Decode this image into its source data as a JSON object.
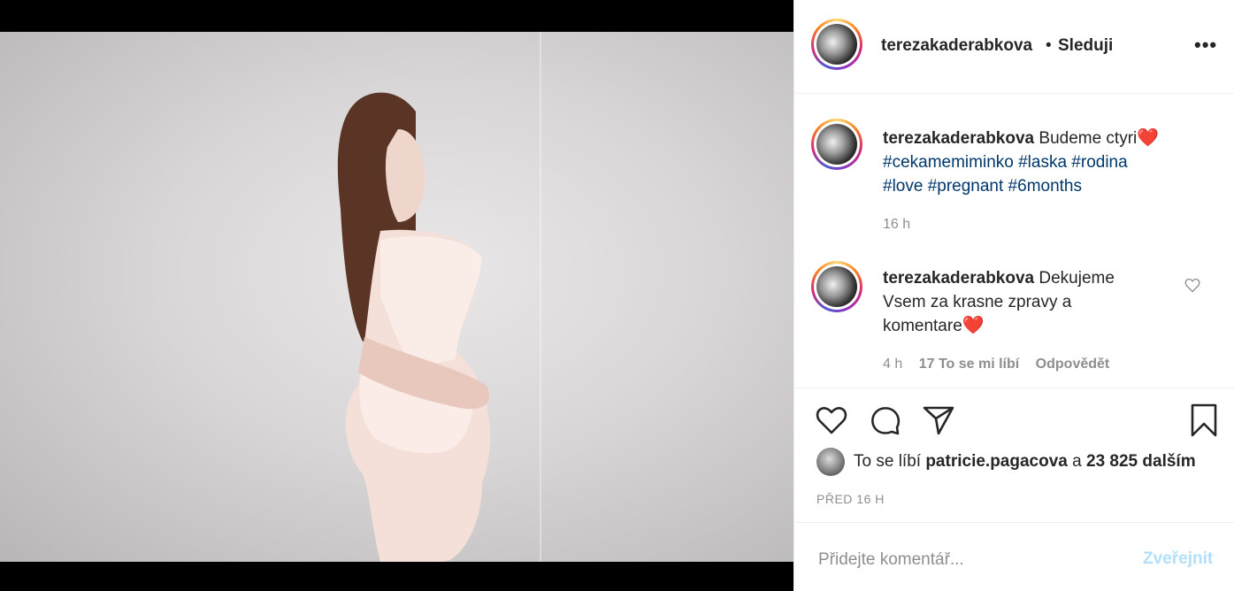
{
  "photo": {
    "alt_name": "post-photo"
  },
  "header": {
    "username": "terezakaderabkova",
    "separator": "•",
    "follow_label": "Sleduji",
    "more_label": "•••"
  },
  "caption": {
    "username": "terezakaderabkova",
    "text": "Budeme ctyri",
    "emoji": "❤️",
    "hashtags_line1": "#cekamemiminko #laska #rodina",
    "hashtags_line2": "#love #pregnant #6months",
    "time": "16 h"
  },
  "reply": {
    "username": "terezakaderabkova",
    "text": "Dekujeme Vsem za krasne zpravy a komentare",
    "emoji": "❤️",
    "time": "4 h",
    "likes": "17 To se mi líbí",
    "reply_label": "Odpovědět"
  },
  "actions": {
    "like_icon": "heart-outline-icon",
    "comment_icon": "comment-bubble-icon",
    "share_icon": "paper-plane-icon",
    "save_icon": "bookmark-icon"
  },
  "likes": {
    "prefix": "To se líbí",
    "user": "patricie.pagacova",
    "middle": "a",
    "count": "23 825 dalším"
  },
  "posted": "PŘED 16 H",
  "comment_box": {
    "placeholder": "Přidejte komentář...",
    "post_label": "Zveřejnit"
  },
  "colors": {
    "link": "#00376b",
    "muted": "#8e8e8e",
    "post_disabled": "#b2dffc",
    "heart": "#ed1c24"
  }
}
